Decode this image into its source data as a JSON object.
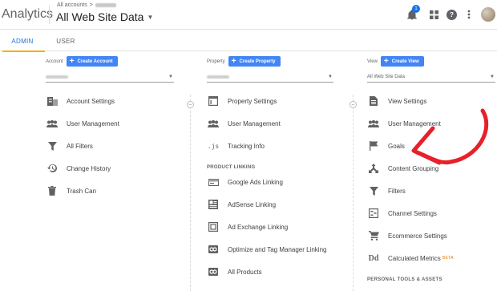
{
  "header": {
    "app_name": "Analytics",
    "breadcrumb_prefix": "All accounts",
    "breadcrumb_sep": ">",
    "property_title": "All Web Site Data",
    "notification_count": "1"
  },
  "tabs": [
    {
      "label": "ADMIN",
      "active": true
    },
    {
      "label": "USER",
      "active": false
    }
  ],
  "account": {
    "label": "Account",
    "create_label": "Create Account",
    "items": [
      {
        "label": "Account Settings",
        "icon": "building-icon"
      },
      {
        "label": "User Management",
        "icon": "people-icon"
      },
      {
        "label": "All Filters",
        "icon": "filter-icon"
      },
      {
        "label": "Change History",
        "icon": "history-icon"
      },
      {
        "label": "Trash Can",
        "icon": "trash-icon"
      }
    ]
  },
  "property": {
    "label": "Property",
    "create_label": "Create Property",
    "items": [
      {
        "label": "Property Settings",
        "icon": "settings-window-icon"
      },
      {
        "label": "User Management",
        "icon": "people-icon"
      },
      {
        "label": "Tracking Info",
        "icon": "js-icon"
      }
    ],
    "section_title": "PRODUCT LINKING",
    "linking_items": [
      {
        "label": "Google Ads Linking",
        "icon": "ads-icon"
      },
      {
        "label": "AdSense Linking",
        "icon": "adsense-icon"
      },
      {
        "label": "Ad Exchange Linking",
        "icon": "adexchange-icon"
      },
      {
        "label": "Optimize and Tag Manager Linking",
        "icon": "link-icon"
      },
      {
        "label": "All Products",
        "icon": "link-icon"
      }
    ]
  },
  "view": {
    "label": "View",
    "create_label": "Create View",
    "selected_view": "All Web Site Data",
    "items": [
      {
        "label": "View Settings",
        "icon": "document-icon"
      },
      {
        "label": "User Management",
        "icon": "people-icon"
      },
      {
        "label": "Goals",
        "icon": "flag-icon"
      },
      {
        "label": "Content Grouping",
        "icon": "grouping-icon"
      },
      {
        "label": "Filters",
        "icon": "filter-icon"
      },
      {
        "label": "Channel Settings",
        "icon": "channel-icon"
      },
      {
        "label": "Ecommerce Settings",
        "icon": "cart-icon"
      },
      {
        "label": "Calculated Metrics",
        "icon": "dd-icon",
        "badge": "BETA"
      }
    ],
    "section_title": "PERSONAL TOOLS & ASSETS"
  },
  "colors": {
    "accent": "#1a73e8",
    "button": "#4285f4",
    "tab_underline": "#f9ab00",
    "annotation_arrow": "#e8202a"
  }
}
